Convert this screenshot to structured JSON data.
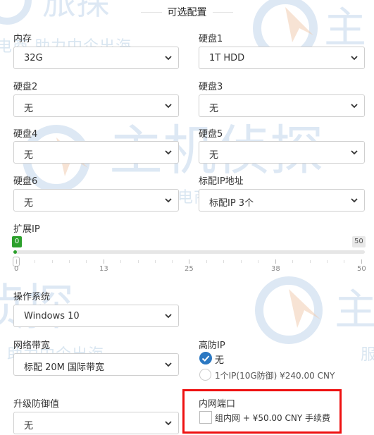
{
  "section_title": "可选配置",
  "fields": {
    "memory": {
      "label": "内存",
      "value": "32G"
    },
    "disk1": {
      "label": "硬盘1",
      "value": "1T HDD"
    },
    "disk2": {
      "label": "硬盘2",
      "value": "无"
    },
    "disk3": {
      "label": "硬盘3",
      "value": "无"
    },
    "disk4": {
      "label": "硬盘4",
      "value": "无"
    },
    "disk5": {
      "label": "硬盘5",
      "value": "无"
    },
    "disk6": {
      "label": "硬盘6",
      "value": "无"
    },
    "ip_address": {
      "label": "标配IP地址",
      "value": "标配IP 3个"
    },
    "os": {
      "label": "操作系统",
      "value": "Windows 10"
    },
    "bandwidth": {
      "label": "网络带宽",
      "value": "标配 20M 国际带宽"
    },
    "ddos_upgrade": {
      "label": "升级防御值",
      "value": "无"
    }
  },
  "extend_ip": {
    "label": "扩展IP",
    "current": "0",
    "max": "50",
    "value": 0,
    "ticks": [
      "0",
      "13",
      "25",
      "38",
      "50"
    ]
  },
  "high_defense_ip": {
    "label": "高防IP",
    "options": [
      {
        "label": "无",
        "selected": true
      },
      {
        "label": "1个IP(10G防御) ¥240.00 CNY",
        "selected": false
      }
    ]
  },
  "intranet_port": {
    "label": "内网端口",
    "option_label": "组内网 + ¥50.00 CNY 手续费",
    "checked": false
  },
  "watermark": {
    "text_1": "电商  助力中企出海",
    "text_2": "服务跨境电商  助力中企出海",
    "text_3": "助力中企出海",
    "text_4": "服"
  },
  "colors": {
    "accent": "#2b78c2",
    "slider_green": "#2ca02c",
    "highlight": "#ee1111"
  }
}
